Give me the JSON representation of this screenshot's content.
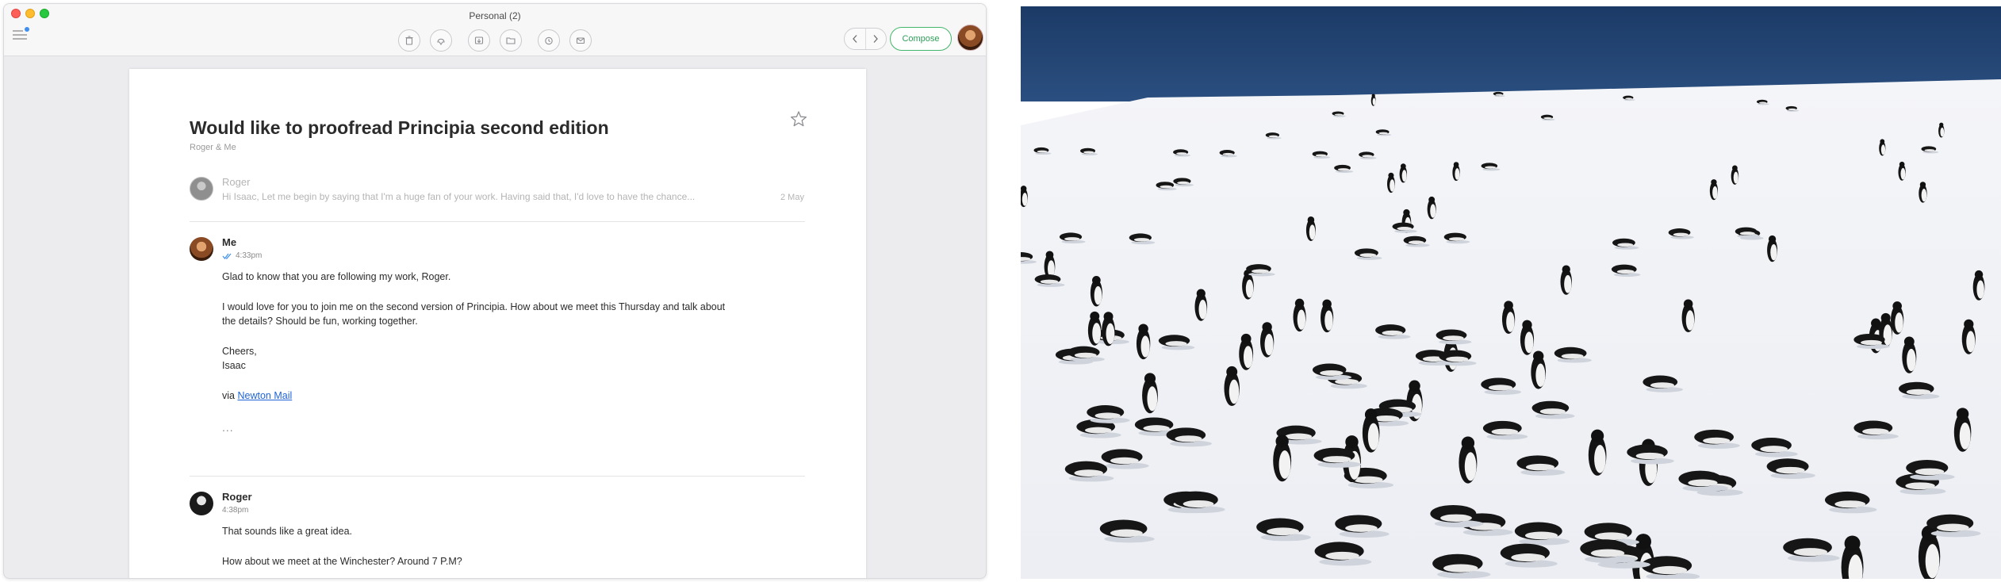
{
  "window": {
    "title": "Personal (2)"
  },
  "toolbar": {
    "icons": [
      "trash-icon",
      "spam-icon",
      "archive-icon",
      "folder-icon",
      "snooze-icon",
      "mark-unread-icon"
    ],
    "compose_label": "Compose"
  },
  "thread": {
    "subject": "Would like to proofread Principia second edition",
    "participants": "Roger & Me",
    "collapsed": {
      "sender": "Roger",
      "preview": "Hi Isaac, Let me begin by saying that I'm a huge fan of your work. Having said that, I'd love to have the chance...",
      "date": "2 May"
    },
    "message1": {
      "sender": "Me",
      "time": "4:33pm",
      "line1": "Glad to know that you are following my work, Roger.",
      "line2": "I would love for you to join me on the second version of Principia. How about we meet this Thursday and talk about",
      "line3": "the details? Should be fun, working together.",
      "line4": "Cheers,",
      "line5": "Isaac",
      "via": "via",
      "link": "Newton Mail",
      "ellipsis": "..."
    },
    "message2": {
      "sender": "Roger",
      "time": "4:38pm",
      "line1": "That sounds like a great idea.",
      "line2": "How about we meet at the Winchester? Around 7 P.M?"
    }
  },
  "colors": {
    "accent_green": "#43b66b",
    "link_blue": "#1f64d6",
    "sea_blue": "#1f3f6e"
  }
}
